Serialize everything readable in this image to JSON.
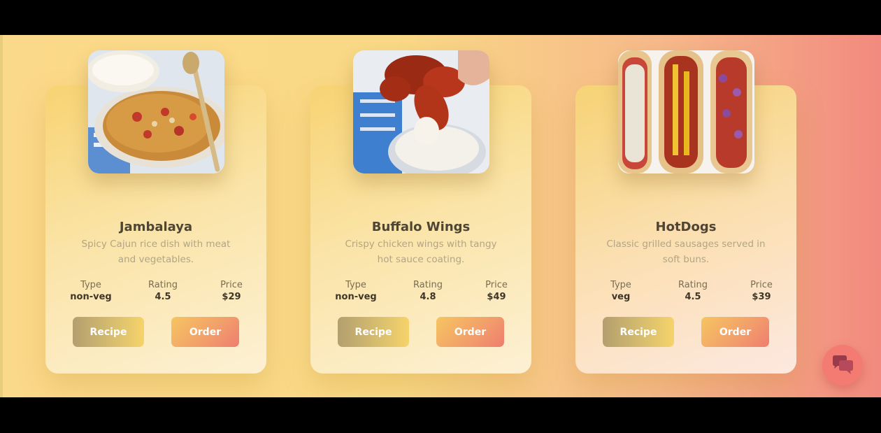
{
  "cards": [
    {
      "title": "Jambalaya",
      "description": "Spicy Cajun rice dish with meat and vegetables.",
      "stats": {
        "type_label": "Type",
        "type_value": "non-veg",
        "rating_label": "Rating",
        "rating_value": "4.5",
        "price_label": "Price",
        "price_value": "$29"
      },
      "recipe_label": "Recipe",
      "order_label": "Order",
      "image": "jambalaya-photo"
    },
    {
      "title": "Buffalo Wings",
      "description": "Crispy chicken wings with tangy hot sauce coating.",
      "stats": {
        "type_label": "Type",
        "type_value": "non-veg",
        "rating_label": "Rating",
        "rating_value": "4.8",
        "price_label": "Price",
        "price_value": "$49"
      },
      "recipe_label": "Recipe",
      "order_label": "Order",
      "image": "buffalo-wings-photo"
    },
    {
      "title": "HotDogs",
      "description": "Classic grilled sausages served in soft buns.",
      "stats": {
        "type_label": "Type",
        "type_value": "veg",
        "rating_label": "Rating",
        "rating_value": "4.5",
        "price_label": "Price",
        "price_value": "$39"
      },
      "recipe_label": "Recipe",
      "order_label": "Order",
      "image": "hotdogs-photo"
    }
  ],
  "chat_button": {
    "icon": "chat-bubbles-icon"
  },
  "colors": {
    "background_start": "#fbd98a",
    "background_end": "#f28a7f",
    "title_text": "#4e4535",
    "description_text": "#b3a584",
    "chat_button": "#f47b72"
  }
}
